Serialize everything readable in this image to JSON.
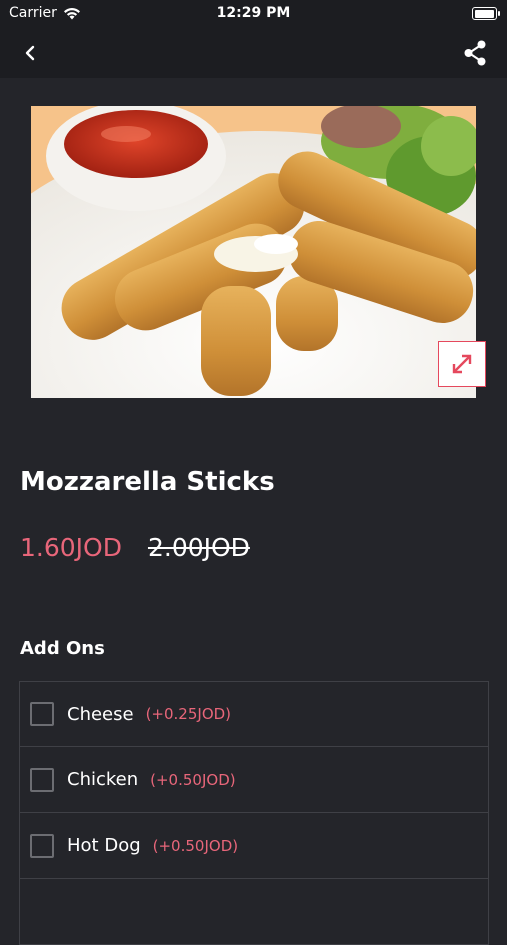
{
  "status_bar": {
    "carrier": "Carrier",
    "time": "12:29 PM",
    "battery_level_percent": 100
  },
  "nav": {
    "back_icon": "chevron-left-icon",
    "share_icon": "share-icon"
  },
  "product": {
    "image_alt": "Mozzarella sticks with dipping sauce and salad",
    "expand_icon": "expand-diagonal-icon",
    "name": "Mozzarella Sticks",
    "price_current": "1.60JOD",
    "price_old": "2.00JOD"
  },
  "addons": {
    "title": "Add Ons",
    "items": [
      {
        "label": "Cheese",
        "price": "(+0.25JOD)",
        "checked": false
      },
      {
        "label": "Chicken",
        "price": "(+0.50JOD)",
        "checked": false
      },
      {
        "label": "Hot Dog",
        "price": "(+0.50JOD)",
        "checked": false
      }
    ]
  },
  "colors": {
    "background": "#24252a",
    "header": "#1c1d21",
    "accent": "#e8667a",
    "border": "#3f4046"
  }
}
